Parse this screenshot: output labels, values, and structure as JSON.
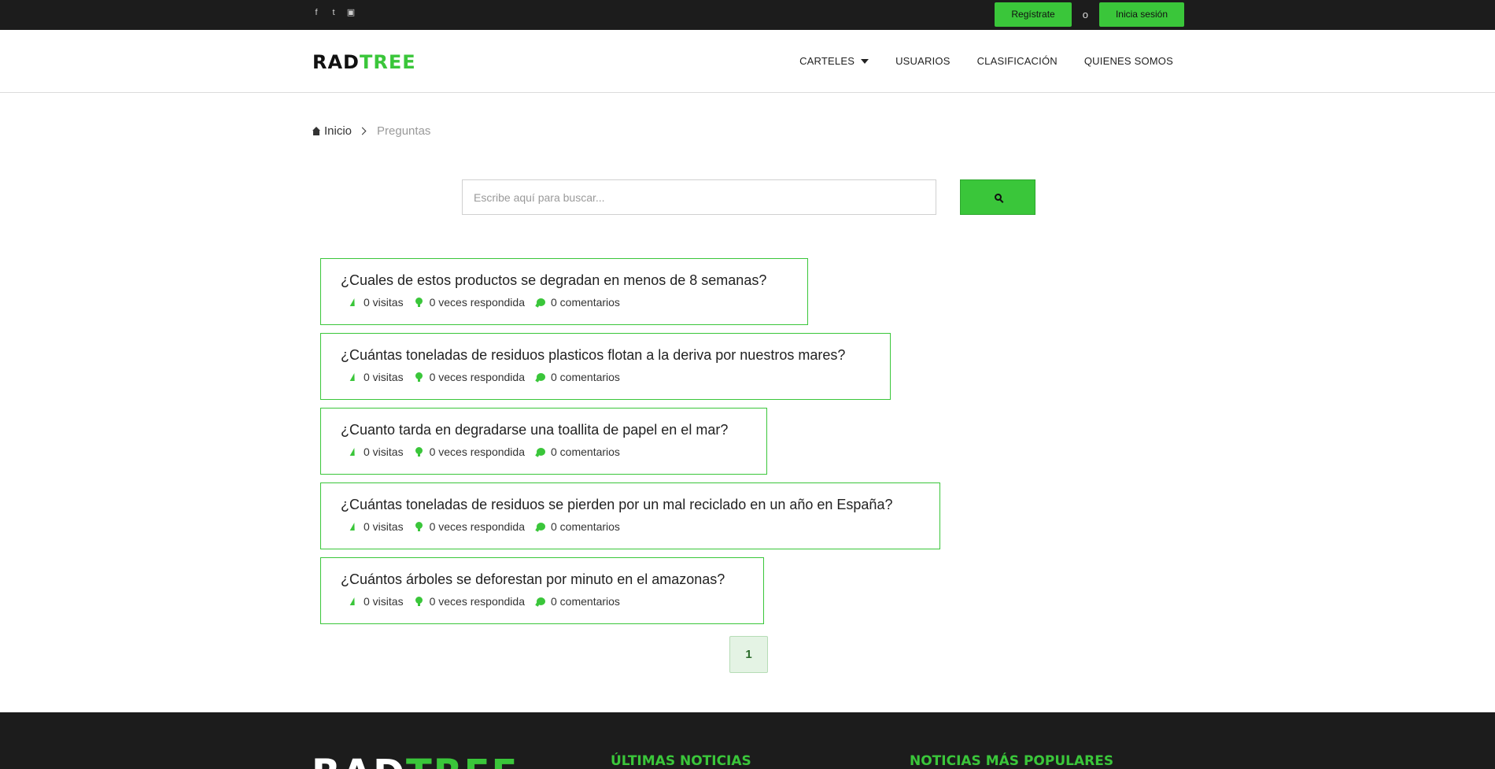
{
  "topbar": {
    "social_icons": [
      "facebook-icon",
      "twitter-icon",
      "instagram-icon"
    ],
    "social_glyphs": [
      "f",
      "t",
      "▣"
    ],
    "register_label": "Regístrate",
    "or_label": "o",
    "login_label": "Inicia sesión"
  },
  "header": {
    "logo_part1": "RAD",
    "logo_part2": "TREE",
    "nav": [
      {
        "label": "CARTELES",
        "has_dropdown": true
      },
      {
        "label": "USUARIOS"
      },
      {
        "label": "CLASIFICACIÓN"
      },
      {
        "label": "QUIENES SOMOS"
      }
    ]
  },
  "breadcrumb": {
    "home": "Inicio",
    "current": "Preguntas"
  },
  "search": {
    "placeholder": "Escribe aquí para buscar...",
    "value": ""
  },
  "questions": [
    {
      "title": "¿Cuales de estos productos se degradan en menos de 8 semanas?",
      "visits": "0 visitas",
      "answered": "0 veces respondida",
      "comments": "0 comentarios"
    },
    {
      "title": "¿Cuántas toneladas de residuos plasticos flotan a la deriva por nuestros mares?",
      "visits": "0 visitas",
      "answered": "0 veces respondida",
      "comments": "0 comentarios"
    },
    {
      "title": "¿Cuanto tarda en degradarse una toallita de papel en el mar?",
      "visits": "0 visitas",
      "answered": "0 veces respondida",
      "comments": "0 comentarios"
    },
    {
      "title": "¿Cuántas toneladas de residuos se pierden por un mal reciclado en un año en España?",
      "visits": "0 visitas",
      "answered": "0 veces respondida",
      "comments": "0 comentarios"
    },
    {
      "title": "¿Cuántos árboles se deforestan por minuto en el amazonas?",
      "visits": "0 visitas",
      "answered": "0 veces respondida",
      "comments": "0 comentarios"
    }
  ],
  "pagination": {
    "current_page": "1"
  },
  "footer": {
    "logo_part1": "RAD",
    "logo_part2": "TREE",
    "latest_news_heading": "ÚLTIMAS NOTICIAS",
    "popular_news_heading": "NOTICIAS MÁS POPULARES"
  },
  "colors": {
    "accent": "#3ac63a",
    "dark_bar": "#1c1c1c"
  }
}
